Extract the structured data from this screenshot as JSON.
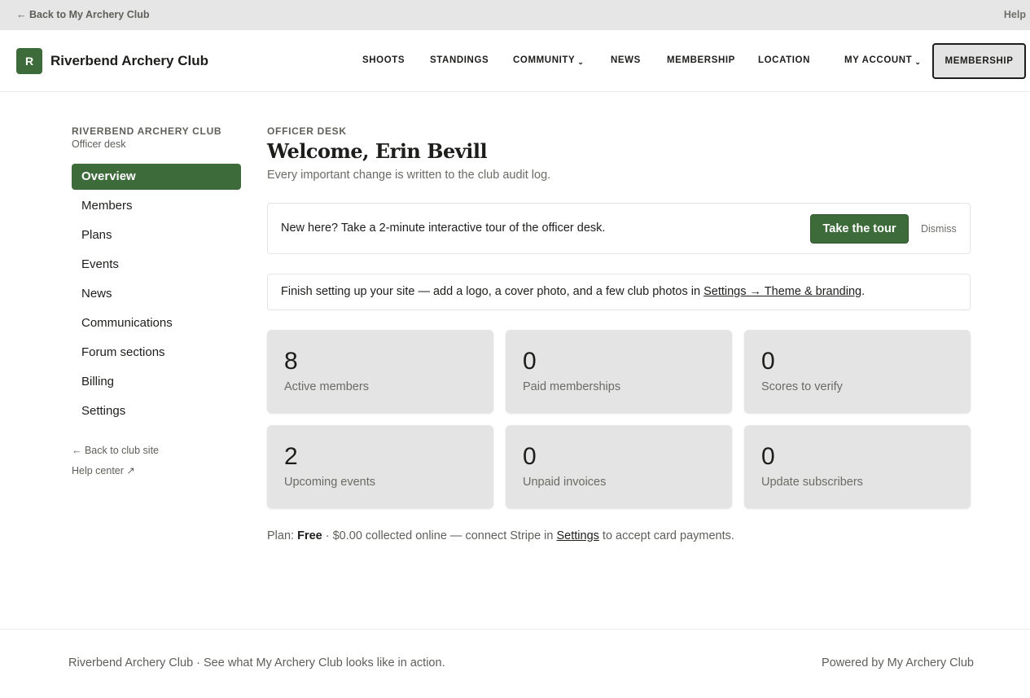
{
  "topbar": {
    "back_label": "← Back to My Archery Club",
    "help_label": "Help"
  },
  "header": {
    "logo_letter": "R",
    "brand": "Riverbend Archery Club",
    "nav": {
      "shoots": "SHOOTS",
      "standings": "STANDINGS",
      "community": "COMMUNITY",
      "news": "NEWS",
      "membership": "MEMBERSHIP",
      "location": "LOCATION",
      "my_account": "MY ACCOUNT",
      "membership_button": "MEMBERSHIP"
    },
    "chevron": "⌄"
  },
  "sidebar": {
    "club": "RIVERBEND ARCHERY CLUB",
    "subtitle": "Officer desk",
    "items": [
      "Overview",
      "Members",
      "Plans",
      "Events",
      "News",
      "Communications",
      "Forum sections",
      "Billing",
      "Settings"
    ],
    "back_link": "← Back to club site",
    "help_link": "Help center ↗"
  },
  "main": {
    "eyebrow": "OFFICER DESK",
    "title": "Welcome, Erin Bevill",
    "subtitle": "Every important change is written to the club audit log.",
    "tour": {
      "text": "New here? Take a 2-minute interactive tour of the officer desk.",
      "button": "Take the tour",
      "dismiss": "Dismiss"
    },
    "setup": {
      "text": "Finish setting up your site — add a logo, a cover photo, and a few club photos in ",
      "link": "Settings → Theme & branding",
      "end": "."
    },
    "stats": [
      {
        "value": "8",
        "label": "Active members"
      },
      {
        "value": "0",
        "label": "Paid memberships"
      },
      {
        "value": "0",
        "label": "Scores to verify"
      },
      {
        "value": "2",
        "label": "Upcoming events"
      },
      {
        "value": "0",
        "label": "Unpaid invoices"
      },
      {
        "value": "0",
        "label": "Update subscribers"
      }
    ],
    "plan": {
      "prefix": "Plan: ",
      "name": "Free",
      "middle": " · $0.00 collected online — connect Stripe in ",
      "link": "Settings",
      "suffix": " to accept card payments."
    }
  },
  "footer": {
    "left": "Riverbend Archery Club · See what My Archery Club looks like in action.",
    "right": "Powered by My Archery Club"
  },
  "colors": {
    "accent": "#3d6b3a",
    "card_bg": "#e4e4e4",
    "topbar_bg": "#e6e6e6"
  }
}
